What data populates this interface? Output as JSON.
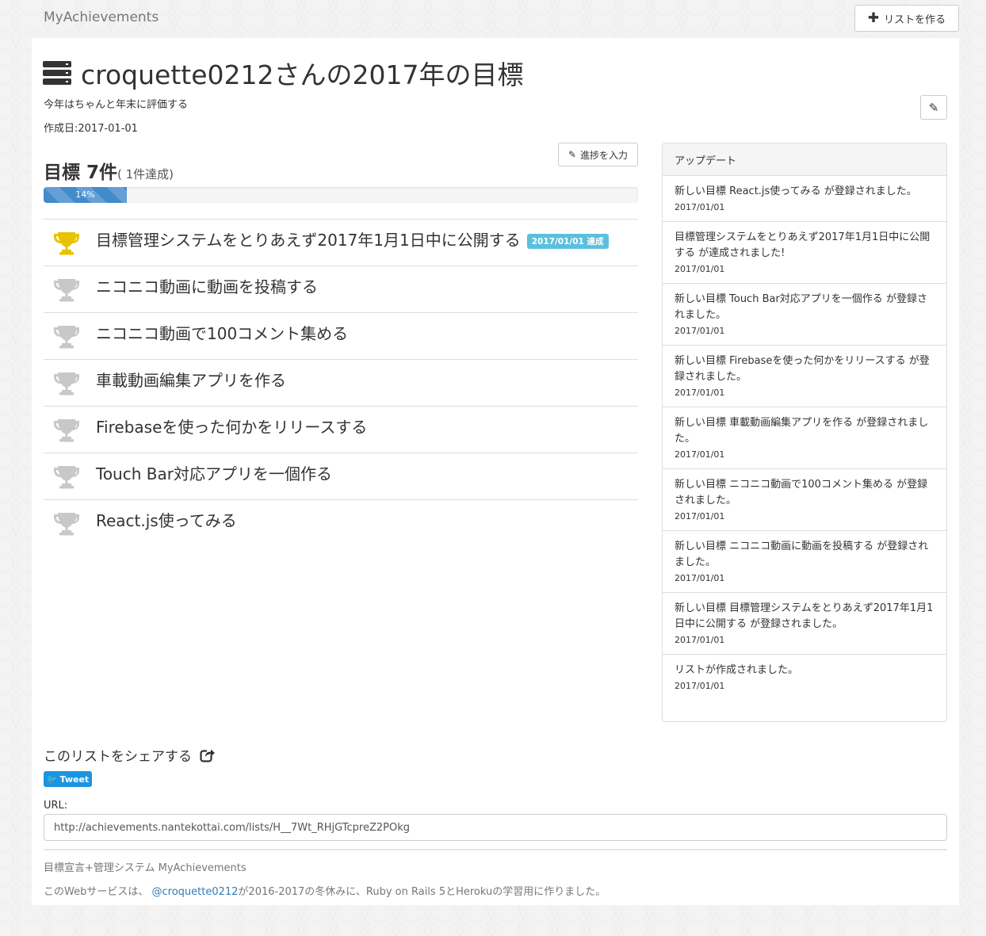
{
  "navbar": {
    "brand": "MyAchievements",
    "new_list_label": "リストを作る"
  },
  "list": {
    "title": "croquette0212さんの2017年の目標",
    "description": "今年はちゃんと年末に評価する",
    "created": "作成日:2017-01-01",
    "progress_button": "進捗を入力",
    "goal_count": "目標 7件",
    "goal_sub": "( 1件達成)",
    "progress_percent": 14,
    "progress_label": "14%"
  },
  "goals": [
    {
      "title": "目標管理システムをとりあえず2017年1月1日中に公開する",
      "achieved": true,
      "badge": "2017/01/01 達成"
    },
    {
      "title": "ニコニコ動画に動画を投稿する",
      "achieved": false
    },
    {
      "title": "ニコニコ動画で100コメント集める",
      "achieved": false
    },
    {
      "title": "車載動画編集アプリを作る",
      "achieved": false
    },
    {
      "title": "Firebaseを使った何かをリリースする",
      "achieved": false
    },
    {
      "title": "Touch Bar対応アプリを一個作る",
      "achieved": false
    },
    {
      "title": "React.js使ってみる",
      "achieved": false
    }
  ],
  "updates": {
    "heading": "アップデート",
    "items": [
      {
        "text": "新しい目標 React.js使ってみる が登録されました。",
        "date": "2017/01/01"
      },
      {
        "text": "目標管理システムをとりあえず2017年1月1日中に公開する が達成されました!",
        "date": "2017/01/01"
      },
      {
        "text": "新しい目標 Touch Bar対応アプリを一個作る が登録されました。",
        "date": "2017/01/01"
      },
      {
        "text": "新しい目標 Firebaseを使った何かをリリースする が登録されました。",
        "date": "2017/01/01"
      },
      {
        "text": "新しい目標 車載動画編集アプリを作る が登録されました。",
        "date": "2017/01/01"
      },
      {
        "text": "新しい目標 ニコニコ動画で100コメント集める が登録されました。",
        "date": "2017/01/01"
      },
      {
        "text": "新しい目標 ニコニコ動画に動画を投稿する が登録されました。",
        "date": "2017/01/01"
      },
      {
        "text": "新しい目標 目標管理システムをとりあえず2017年1月1日中に公開する が登録されました。",
        "date": "2017/01/01"
      },
      {
        "text": "リストが作成されました。",
        "date": "2017/01/01"
      }
    ]
  },
  "share": {
    "heading": "このリストをシェアする",
    "tweet_label": "Tweet",
    "url_label": "URL:",
    "url_value": "http://achievements.nantekottai.com/lists/H__7Wt_RHjGTcpreZ2POkg"
  },
  "footer": {
    "line1": "目標宣言+管理システム MyAchievements",
    "line2_prefix": "このWebサービスは、 ",
    "line2_link": "@croquette0212",
    "line2_suffix": "が2016-2017の冬休みに、Ruby on Rails 5とHerokuの学習用に作りました。"
  },
  "colors": {
    "trophy_gold": "#e8c200",
    "trophy_grey": "#c8c8c8",
    "progress": "#428bca",
    "badge": "#5bc0de",
    "tweet": "#1b95e0",
    "link": "#337ab7"
  }
}
